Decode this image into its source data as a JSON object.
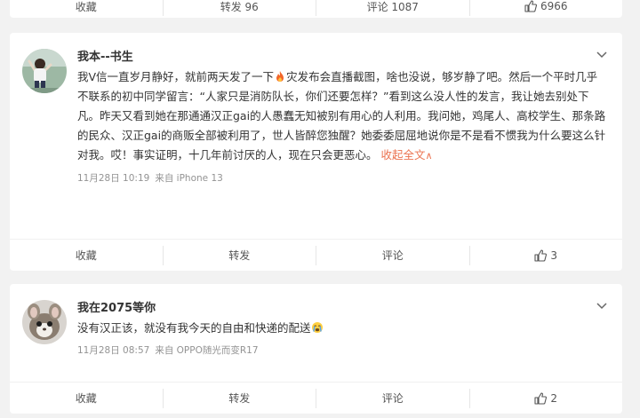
{
  "top_bar": {
    "fav_label": "收藏",
    "repost_label": "转发 96",
    "comment_label": "评论 1087",
    "like_label": "6966"
  },
  "post1": {
    "username": "我本--书生",
    "text_a": "我V信一直岁月静好，就前两天发了一下",
    "text_b": "灾发布会直播截图，啥也没说，够岁静了吧。然后一个平时几乎不联系的初中同学留言：“人家只是消防队长，你们还要怎样？”看到这么没人性的发言，我让她去别处下凡。昨天又看到她在那通通汉正gai的人愚蠢无知被别有用心的人利用。我问她，鸡尾人、高校学生、那条路的民众、汉正gai的商贩全部被利用了，世人皆醉您独醒？她委委屈屈地说你是不是看不惯我为什么要这么针对我。哎！事实证明，十几年前讨厌的人，现在只会更恶心。",
    "expand_label": "收起全文",
    "time": "11月28日 10:19",
    "source": "来自 iPhone 13",
    "fav_label": "收藏",
    "repost_label": "转发",
    "comment_label": "评论",
    "like_count": "3",
    "fire_icon": "fire-icon"
  },
  "post2": {
    "username": "我在2075等你",
    "text": "没有汉正该，就没有我今天的自由和快递的配送",
    "time": "11月28日 08:57",
    "source": "来自 OPPO随光而变R17",
    "fav_label": "收藏",
    "repost_label": "转发",
    "comment_label": "评论",
    "like_count": "2",
    "emoji_icon": "crying-face-icon"
  },
  "colors": {
    "accent": "#eb7350",
    "meta": "#939393",
    "background": "#f2f2f2"
  }
}
